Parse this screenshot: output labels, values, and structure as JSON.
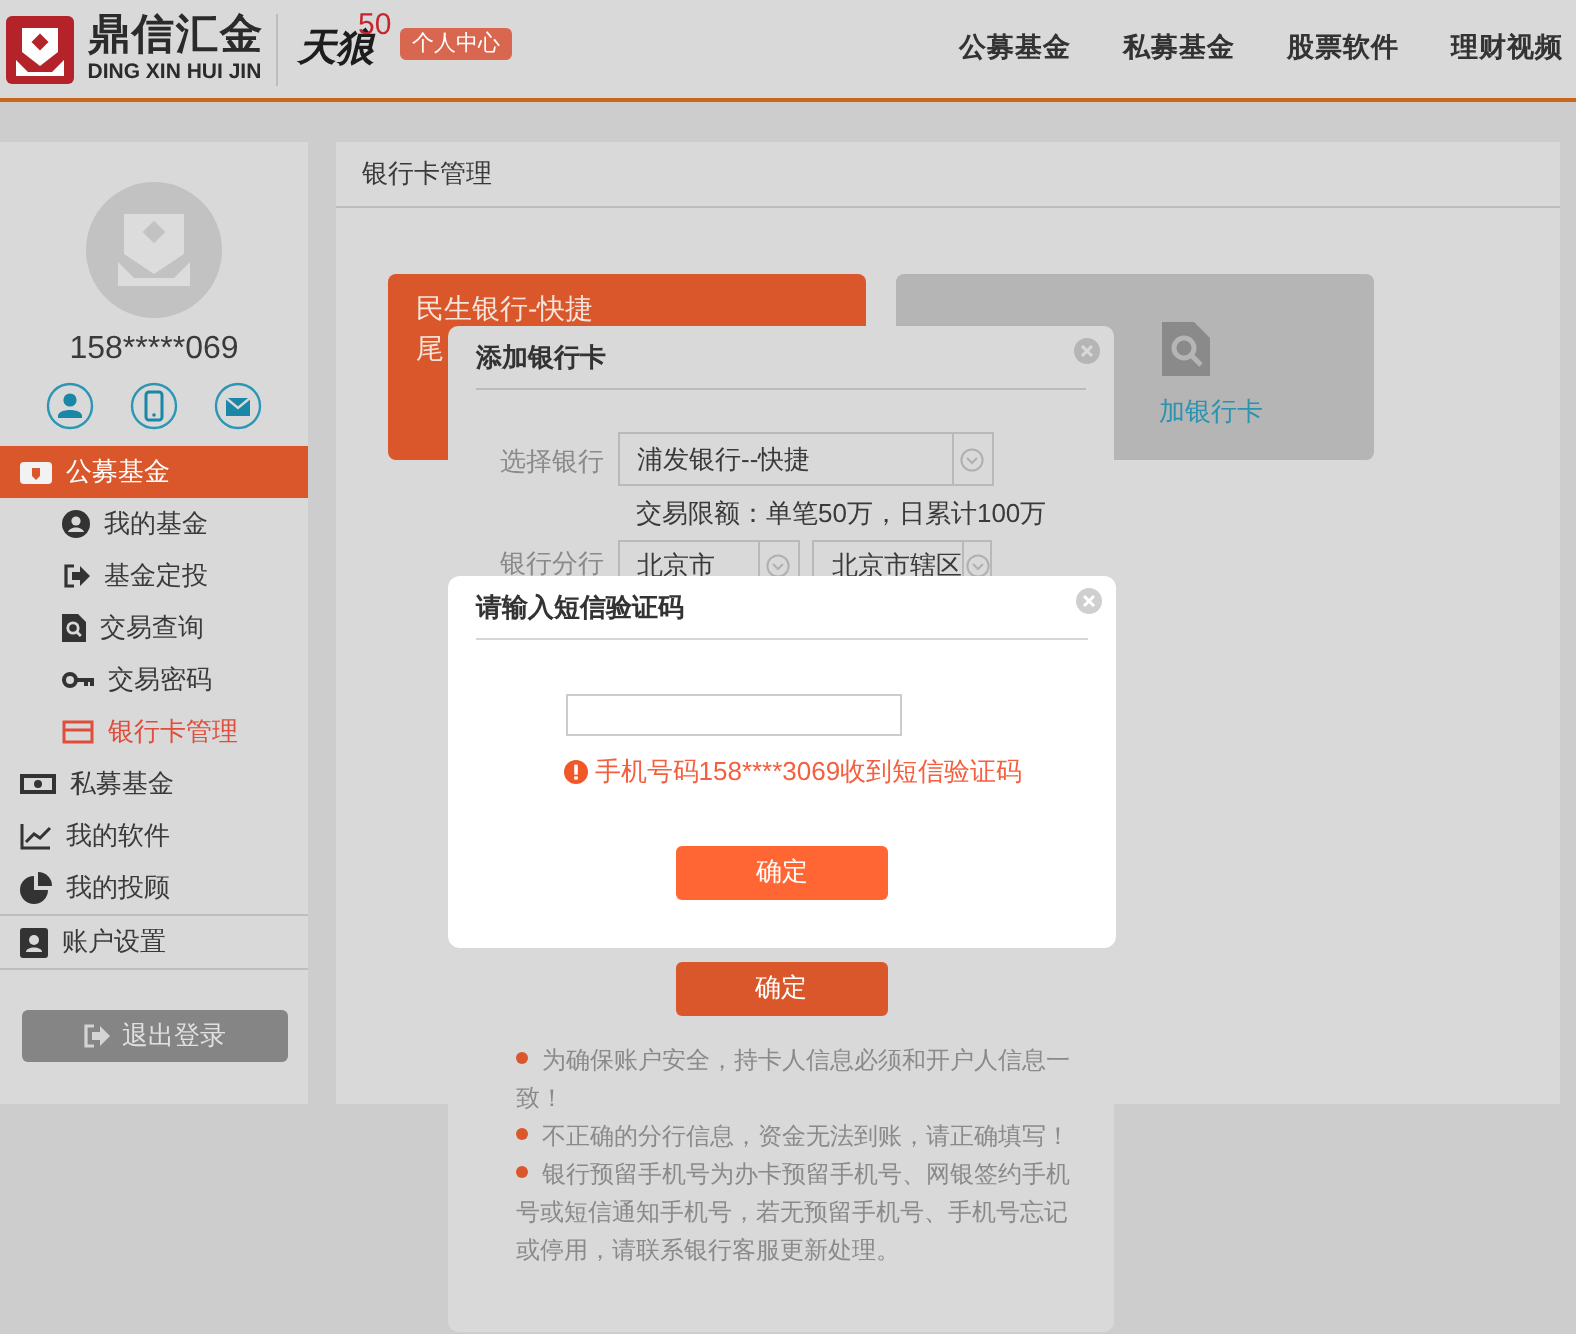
{
  "header": {
    "brand": "鼎信汇金",
    "brand_latin": "DING XIN HUI JIN",
    "sub_brand": "天狼",
    "sub_brand_number": "50",
    "user_center": "个人中心",
    "nav": [
      {
        "label": "公募基金"
      },
      {
        "label": "私募基金"
      },
      {
        "label": "股票软件"
      },
      {
        "label": "理财视频"
      }
    ]
  },
  "sidebar": {
    "phone": "158*****069",
    "menu": [
      {
        "label": "公募基金",
        "selected": true,
        "children": [
          {
            "label": "我的基金",
            "selected": false
          },
          {
            "label": "基金定投",
            "selected": false
          },
          {
            "label": "交易查询",
            "selected": false
          },
          {
            "label": "交易密码",
            "selected": false
          },
          {
            "label": "银行卡管理",
            "selected": true
          }
        ]
      },
      {
        "label": "私募基金",
        "selected": false
      },
      {
        "label": "我的软件",
        "selected": false
      },
      {
        "label": "我的投顾",
        "selected": false
      },
      {
        "label": "账户设置",
        "selected": false
      }
    ],
    "logout": "退出登录"
  },
  "main": {
    "title": "银行卡管理",
    "cards": [
      {
        "kind": "bank",
        "lines": [
          "民生银行-快捷",
          "尾"
        ]
      },
      {
        "kind": "add",
        "label": "加银行卡"
      }
    ]
  },
  "add_card_dialog": {
    "title": "添加银行卡",
    "bank_label": "选择银行",
    "bank_value": "浦发银行--快捷",
    "limit_note": "交易限额：单笔50万，日累计100万",
    "branch_label": "银行分行",
    "branch_city": "北京市",
    "branch_district": "北京市辖区",
    "confirm": "确定",
    "notes": [
      "为确保账户安全，持卡人信息必须和开户人信息一致！",
      "不正确的分行信息，资金无法到账，请正确填写！",
      "银行预留手机号为办卡预留手机号、网银签约手机号或短信通知手机号，若无预留手机号、手机号忘记或停用，请联系银行客服更新处理。"
    ]
  },
  "sms_dialog": {
    "title": "请输入短信验证码",
    "message": "手机号码158****3069收到短信验证码",
    "confirm": "确定"
  }
}
